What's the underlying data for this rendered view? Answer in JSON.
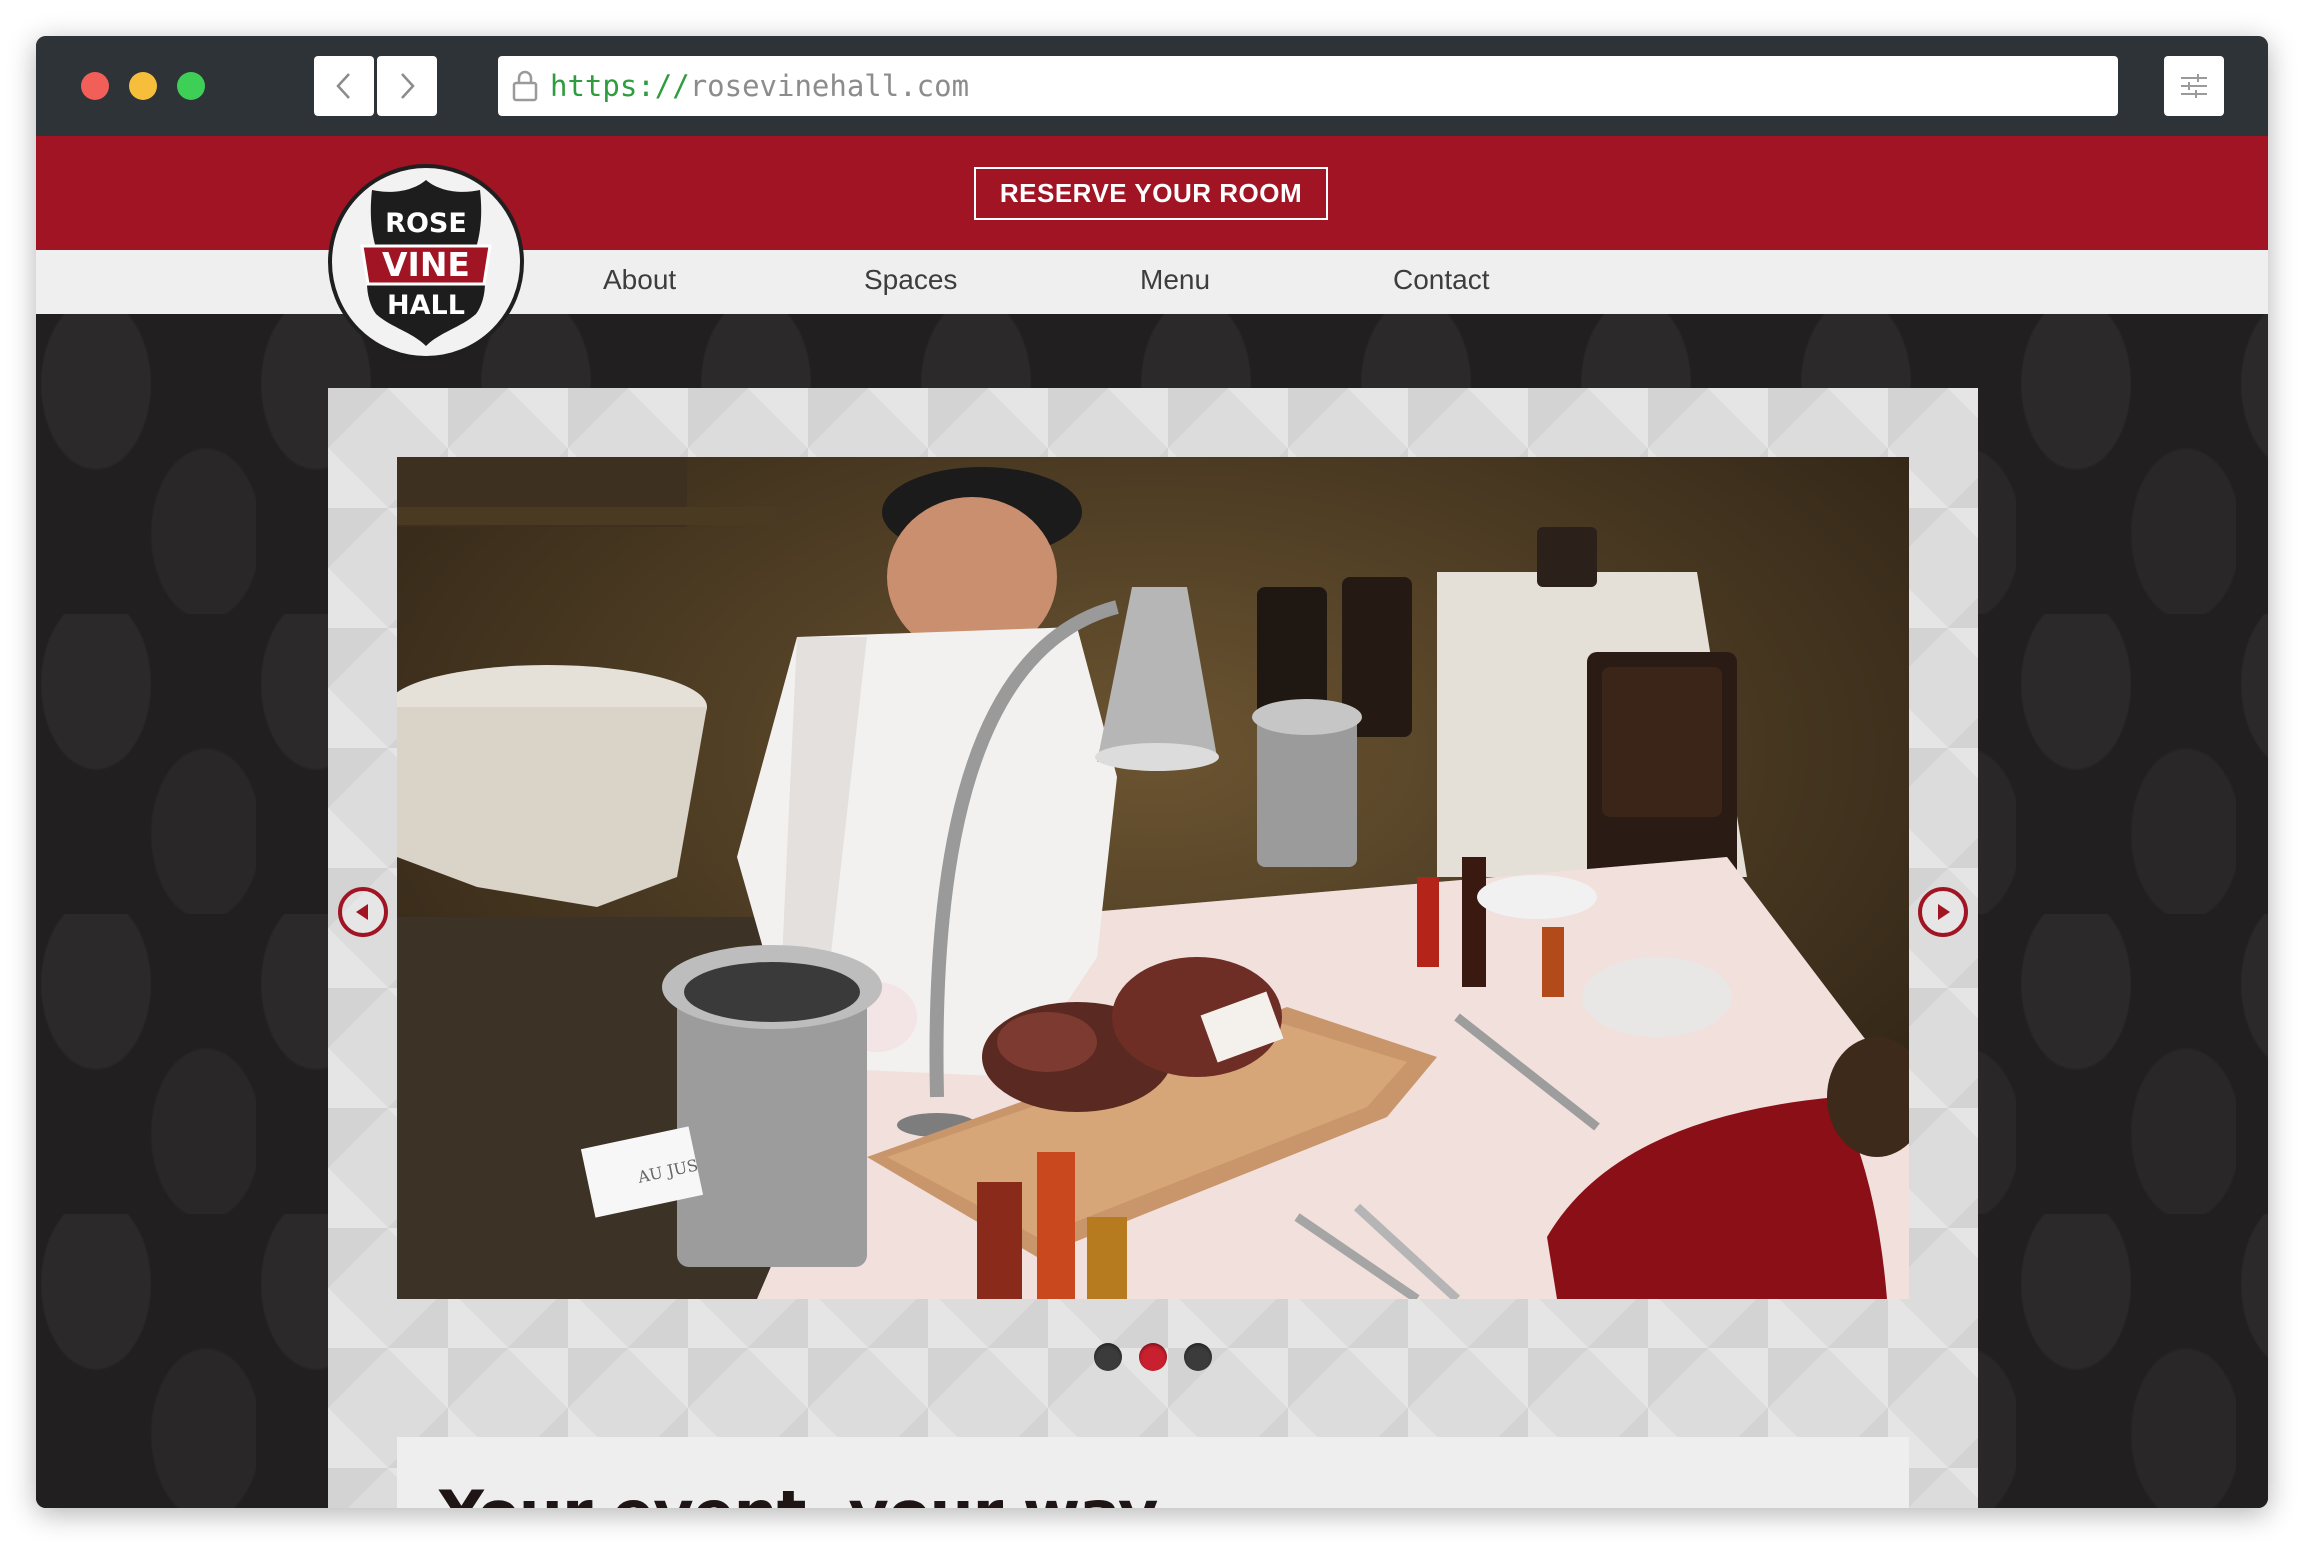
{
  "browser": {
    "url_scheme": "https://",
    "url_host": "rosevinehall.com",
    "back_icon": "chevron-left-icon",
    "forward_icon": "chevron-right-icon",
    "lock_icon": "lock-icon",
    "settings_icon": "sliders-icon"
  },
  "header": {
    "reserve_label": "RESERVE YOUR ROOM",
    "brand_color": "#a01423"
  },
  "logo": {
    "line1": "ROSE",
    "line2": "VINE",
    "line3": "HALL"
  },
  "nav": {
    "items": [
      {
        "label": "About"
      },
      {
        "label": "Spaces"
      },
      {
        "label": "Menu"
      },
      {
        "label": "Contact"
      }
    ]
  },
  "slider": {
    "prev_icon": "play-left-icon",
    "next_icon": "play-right-icon",
    "dot_count": 3,
    "active_dot": 2,
    "slide_content": "chef carving roast beef at a buffet carving station",
    "card_label": "AU JUS"
  },
  "content": {
    "tagline": "Your event, your way."
  }
}
